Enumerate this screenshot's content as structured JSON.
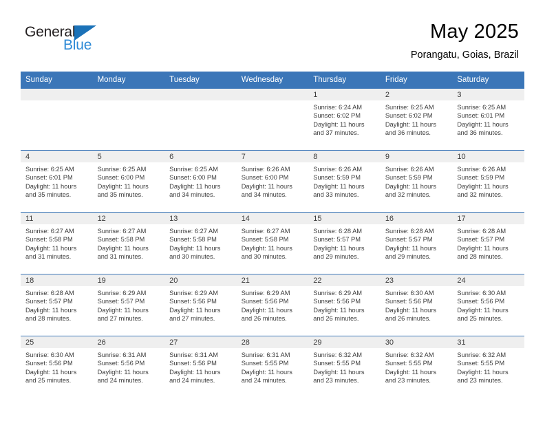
{
  "logo": {
    "text_top": "General",
    "text_bottom": "Blue",
    "triangle_color": "#1b72b8",
    "blue_color": "#2e8ad6"
  },
  "header": {
    "title": "May 2025",
    "subtitle": "Porangatu, Goias, Brazil"
  },
  "theme": {
    "header_blue": "#3b76b8",
    "day_band_gray": "#efefef",
    "text_color": "#3b3b3b"
  },
  "weekday_headers": [
    "Sunday",
    "Monday",
    "Tuesday",
    "Wednesday",
    "Thursday",
    "Friday",
    "Saturday"
  ],
  "weeks": [
    [
      {
        "day": "",
        "lines": []
      },
      {
        "day": "",
        "lines": []
      },
      {
        "day": "",
        "lines": []
      },
      {
        "day": "",
        "lines": []
      },
      {
        "day": "1",
        "lines": [
          "Sunrise: 6:24 AM",
          "Sunset: 6:02 PM",
          "Daylight: 11 hours",
          "and 37 minutes."
        ]
      },
      {
        "day": "2",
        "lines": [
          "Sunrise: 6:25 AM",
          "Sunset: 6:02 PM",
          "Daylight: 11 hours",
          "and 36 minutes."
        ]
      },
      {
        "day": "3",
        "lines": [
          "Sunrise: 6:25 AM",
          "Sunset: 6:01 PM",
          "Daylight: 11 hours",
          "and 36 minutes."
        ]
      }
    ],
    [
      {
        "day": "4",
        "lines": [
          "Sunrise: 6:25 AM",
          "Sunset: 6:01 PM",
          "Daylight: 11 hours",
          "and 35 minutes."
        ]
      },
      {
        "day": "5",
        "lines": [
          "Sunrise: 6:25 AM",
          "Sunset: 6:00 PM",
          "Daylight: 11 hours",
          "and 35 minutes."
        ]
      },
      {
        "day": "6",
        "lines": [
          "Sunrise: 6:25 AM",
          "Sunset: 6:00 PM",
          "Daylight: 11 hours",
          "and 34 minutes."
        ]
      },
      {
        "day": "7",
        "lines": [
          "Sunrise: 6:26 AM",
          "Sunset: 6:00 PM",
          "Daylight: 11 hours",
          "and 34 minutes."
        ]
      },
      {
        "day": "8",
        "lines": [
          "Sunrise: 6:26 AM",
          "Sunset: 5:59 PM",
          "Daylight: 11 hours",
          "and 33 minutes."
        ]
      },
      {
        "day": "9",
        "lines": [
          "Sunrise: 6:26 AM",
          "Sunset: 5:59 PM",
          "Daylight: 11 hours",
          "and 32 minutes."
        ]
      },
      {
        "day": "10",
        "lines": [
          "Sunrise: 6:26 AM",
          "Sunset: 5:59 PM",
          "Daylight: 11 hours",
          "and 32 minutes."
        ]
      }
    ],
    [
      {
        "day": "11",
        "lines": [
          "Sunrise: 6:27 AM",
          "Sunset: 5:58 PM",
          "Daylight: 11 hours",
          "and 31 minutes."
        ]
      },
      {
        "day": "12",
        "lines": [
          "Sunrise: 6:27 AM",
          "Sunset: 5:58 PM",
          "Daylight: 11 hours",
          "and 31 minutes."
        ]
      },
      {
        "day": "13",
        "lines": [
          "Sunrise: 6:27 AM",
          "Sunset: 5:58 PM",
          "Daylight: 11 hours",
          "and 30 minutes."
        ]
      },
      {
        "day": "14",
        "lines": [
          "Sunrise: 6:27 AM",
          "Sunset: 5:58 PM",
          "Daylight: 11 hours",
          "and 30 minutes."
        ]
      },
      {
        "day": "15",
        "lines": [
          "Sunrise: 6:28 AM",
          "Sunset: 5:57 PM",
          "Daylight: 11 hours",
          "and 29 minutes."
        ]
      },
      {
        "day": "16",
        "lines": [
          "Sunrise: 6:28 AM",
          "Sunset: 5:57 PM",
          "Daylight: 11 hours",
          "and 29 minutes."
        ]
      },
      {
        "day": "17",
        "lines": [
          "Sunrise: 6:28 AM",
          "Sunset: 5:57 PM",
          "Daylight: 11 hours",
          "and 28 minutes."
        ]
      }
    ],
    [
      {
        "day": "18",
        "lines": [
          "Sunrise: 6:28 AM",
          "Sunset: 5:57 PM",
          "Daylight: 11 hours",
          "and 28 minutes."
        ]
      },
      {
        "day": "19",
        "lines": [
          "Sunrise: 6:29 AM",
          "Sunset: 5:57 PM",
          "Daylight: 11 hours",
          "and 27 minutes."
        ]
      },
      {
        "day": "20",
        "lines": [
          "Sunrise: 6:29 AM",
          "Sunset: 5:56 PM",
          "Daylight: 11 hours",
          "and 27 minutes."
        ]
      },
      {
        "day": "21",
        "lines": [
          "Sunrise: 6:29 AM",
          "Sunset: 5:56 PM",
          "Daylight: 11 hours",
          "and 26 minutes."
        ]
      },
      {
        "day": "22",
        "lines": [
          "Sunrise: 6:29 AM",
          "Sunset: 5:56 PM",
          "Daylight: 11 hours",
          "and 26 minutes."
        ]
      },
      {
        "day": "23",
        "lines": [
          "Sunrise: 6:30 AM",
          "Sunset: 5:56 PM",
          "Daylight: 11 hours",
          "and 26 minutes."
        ]
      },
      {
        "day": "24",
        "lines": [
          "Sunrise: 6:30 AM",
          "Sunset: 5:56 PM",
          "Daylight: 11 hours",
          "and 25 minutes."
        ]
      }
    ],
    [
      {
        "day": "25",
        "lines": [
          "Sunrise: 6:30 AM",
          "Sunset: 5:56 PM",
          "Daylight: 11 hours",
          "and 25 minutes."
        ]
      },
      {
        "day": "26",
        "lines": [
          "Sunrise: 6:31 AM",
          "Sunset: 5:56 PM",
          "Daylight: 11 hours",
          "and 24 minutes."
        ]
      },
      {
        "day": "27",
        "lines": [
          "Sunrise: 6:31 AM",
          "Sunset: 5:56 PM",
          "Daylight: 11 hours",
          "and 24 minutes."
        ]
      },
      {
        "day": "28",
        "lines": [
          "Sunrise: 6:31 AM",
          "Sunset: 5:55 PM",
          "Daylight: 11 hours",
          "and 24 minutes."
        ]
      },
      {
        "day": "29",
        "lines": [
          "Sunrise: 6:32 AM",
          "Sunset: 5:55 PM",
          "Daylight: 11 hours",
          "and 23 minutes."
        ]
      },
      {
        "day": "30",
        "lines": [
          "Sunrise: 6:32 AM",
          "Sunset: 5:55 PM",
          "Daylight: 11 hours",
          "and 23 minutes."
        ]
      },
      {
        "day": "31",
        "lines": [
          "Sunrise: 6:32 AM",
          "Sunset: 5:55 PM",
          "Daylight: 11 hours",
          "and 23 minutes."
        ]
      }
    ]
  ]
}
